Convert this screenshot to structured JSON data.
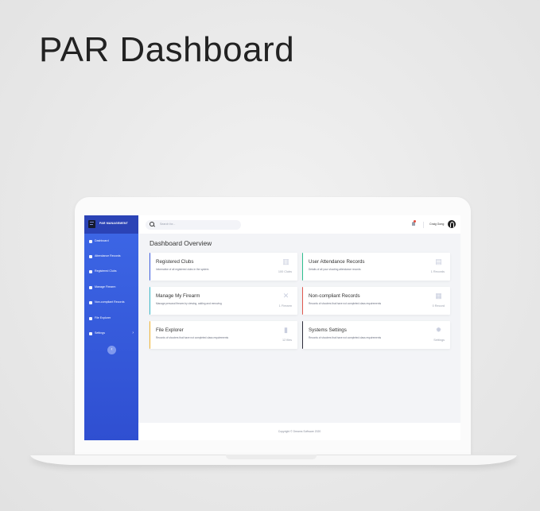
{
  "hero": {
    "title": "PAR Dashboard"
  },
  "app": {
    "brand": "PAR MANAGEMENT",
    "sidebar": {
      "items": [
        {
          "label": "Dashboard",
          "icon": "home-icon"
        },
        {
          "label": "Attendance Records",
          "icon": "clipboard-icon"
        },
        {
          "label": "Registered Clubs",
          "icon": "building-icon"
        },
        {
          "label": "Manage Firearm",
          "icon": "crosshair-icon"
        },
        {
          "label": "Non-compliant Records",
          "icon": "warning-icon"
        },
        {
          "label": "File Explorer",
          "icon": "folder-icon"
        },
        {
          "label": "Settings",
          "icon": "gear-icon"
        }
      ],
      "collapse_glyph": "‹"
    },
    "header": {
      "search_placeholder": "Search for...",
      "user_name": "Craig Gong"
    },
    "main": {
      "title": "Dashboard Overview",
      "cards": [
        {
          "title": "Registered Clubs",
          "description": "Informative of all registered clubs in the system",
          "value": "100 Clubs",
          "icon": "building-icon",
          "accent": "#3d5ce0"
        },
        {
          "title": "User Attendance Records",
          "description": "Details of all your shooting attendance records",
          "value": "1 Records",
          "icon": "clipboard-icon",
          "accent": "#2fbf8f"
        },
        {
          "title": "Manage My Firearm",
          "description": "Manage personal firearm by viewing, adding and removing",
          "value": "1 Firearm",
          "icon": "tools-icon",
          "accent": "#37b9c9"
        },
        {
          "title": "Non-compliant Records",
          "description": "Records of shooters that have not completed class requirements",
          "value": "0 Record",
          "icon": "calendar-icon",
          "accent": "#e0584f"
        },
        {
          "title": "File Explorer",
          "description": "Records of shooters that have not completed class requirements",
          "value": "12 files",
          "icon": "file-icon",
          "accent": "#f2b431"
        },
        {
          "title": "Systems Settings",
          "description": "Records of shooters that have not completed class requirements",
          "value": "Settings",
          "icon": "gear-icon",
          "accent": "#2d2d3a"
        }
      ]
    },
    "footer": {
      "text": "Copyright © Dreams Software 2020"
    }
  }
}
